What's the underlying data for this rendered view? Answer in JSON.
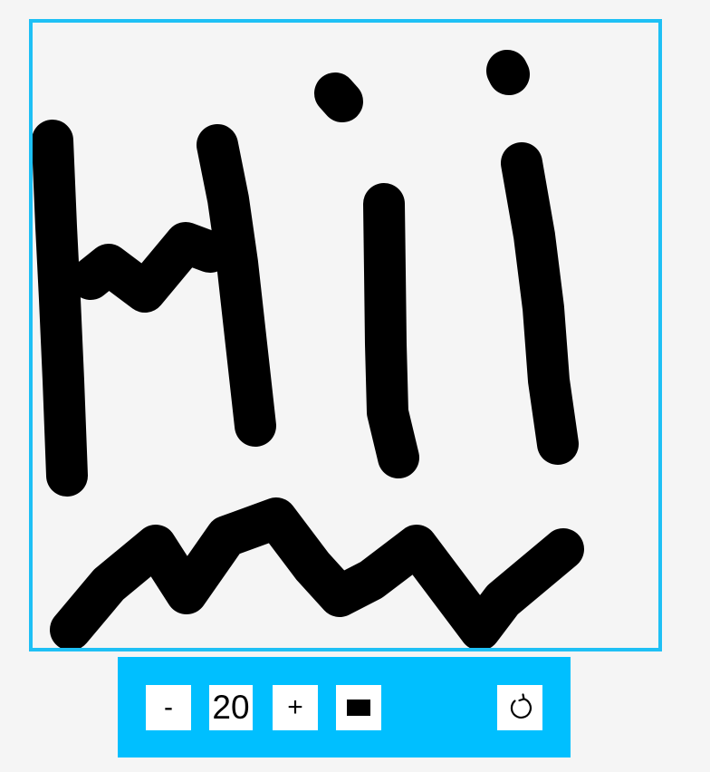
{
  "canvas": {
    "border_color": "#1ec0f5",
    "background_color": "#f5f5f5",
    "stroke_color": "#000000"
  },
  "toolbar": {
    "background_color": "#00bfff",
    "decrease_label": "-",
    "brush_size": "20",
    "increase_label": "+",
    "color_tool_icon": "filled-square-icon",
    "reset_icon": "refresh-icon"
  }
}
